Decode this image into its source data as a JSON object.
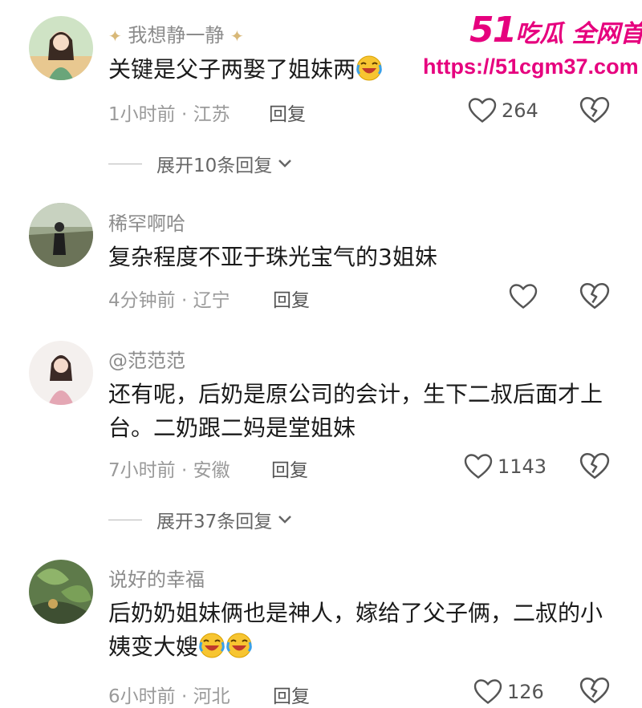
{
  "watermark": {
    "brand_num": "51",
    "brand_text": "吃瓜 全网首发",
    "url": "https://51cgm37.com"
  },
  "comments": [
    {
      "username": "我想静一静",
      "text": "关键是父子两娶了姐妹两",
      "time": "1小时前",
      "location": "江苏",
      "reply": "回复",
      "likes": "264",
      "expand": "展开10条回复"
    },
    {
      "username": "稀罕啊哈",
      "text": "复杂程度不亚于珠光宝气的3姐妹",
      "time": "4分钟前",
      "location": "辽宁",
      "reply": "回复",
      "likes": ""
    },
    {
      "username": "@范范范",
      "text": "还有呢，后奶是原公司的会计，生下二叔后面才上台。二奶跟二妈是堂姐妹",
      "time": "7小时前",
      "location": "安徽",
      "reply": "回复",
      "likes": "1143",
      "expand": "展开37条回复"
    },
    {
      "username": "说好的幸福",
      "text": "后奶奶姐妹俩也是神人，嫁给了父子俩，二叔的小姨变大嫂",
      "time": "6小时前",
      "location": "河北",
      "reply": "回复",
      "likes": "126"
    }
  ],
  "icons": {
    "like": "heart-outline-icon",
    "dislike": "broken-heart-icon",
    "expand": "chevron-down-icon",
    "emoji": "crying-laughing-emoji"
  },
  "colors": {
    "brand": "#e6007e",
    "meta": "#9a9a9a",
    "text": "#1a1a1a"
  }
}
